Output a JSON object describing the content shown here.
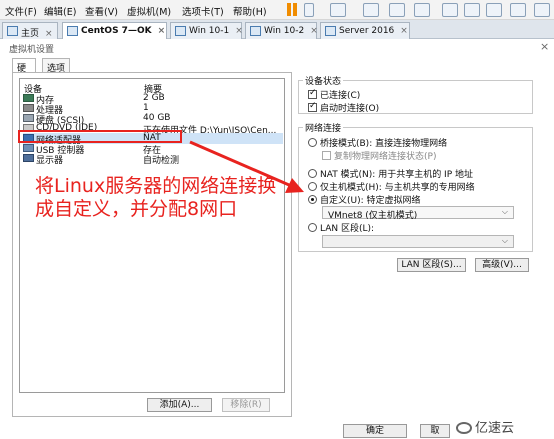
{
  "menubar": {
    "items": [
      "文件(F)",
      "编辑(E)",
      "查看(V)",
      "虚拟机(M)",
      "选项卡(T)",
      "帮助(H)"
    ]
  },
  "tabs": [
    {
      "label": "主页"
    },
    {
      "label": "CentOS 7—OK"
    },
    {
      "label": "Win 10-1"
    },
    {
      "label": "Win 10-2"
    },
    {
      "label": "Server 2016"
    }
  ],
  "dialog": {
    "title": "虚拟机设置",
    "tabs": [
      "硬件",
      "选项"
    ],
    "device_header": "设备",
    "summary_header": "摘要",
    "devices": [
      {
        "name": "内存",
        "summary": "2 GB"
      },
      {
        "name": "处理器",
        "summary": "1"
      },
      {
        "name": "硬盘 (SCSI)",
        "summary": "40 GB"
      },
      {
        "name": "CD/DVD (IDE)",
        "summary": "正在使用文件 D:\\Yun\\ISO\\Cen..."
      },
      {
        "name": "网络适配器",
        "summary": "NAT"
      },
      {
        "name": "USB 控制器",
        "summary": "存在"
      },
      {
        "name": "显示器",
        "summary": "自动检测"
      }
    ],
    "add_button": "添加(A)...",
    "remove_button": "移除(R)",
    "device_status": {
      "title": "设备状态",
      "connected": "已连接(C)",
      "connect_on_start": "启动时连接(O)"
    },
    "network": {
      "title": "网络连接",
      "bridged": "桥接模式(B): 直接连接物理网络",
      "replicate": "复制物理网络连接状态(P)",
      "nat": "NAT 模式(N): 用于共享主机的 IP 地址",
      "host_only": "仅主机模式(H): 与主机共享的专用网络",
      "custom": "自定义(U): 特定虚拟网络",
      "custom_value": "VMnet8 (仅主机模式)",
      "lan": "LAN 区段(L):",
      "lan_button": "LAN 区段(S)...",
      "advanced_button": "高级(V)..."
    },
    "ok_button": "确定",
    "cancel_button": "取"
  },
  "annotation": {
    "text": "将Linux服务器的网络连接换成自定义，并分配8网口",
    "color": "#e8231f"
  },
  "watermark": "亿速云"
}
